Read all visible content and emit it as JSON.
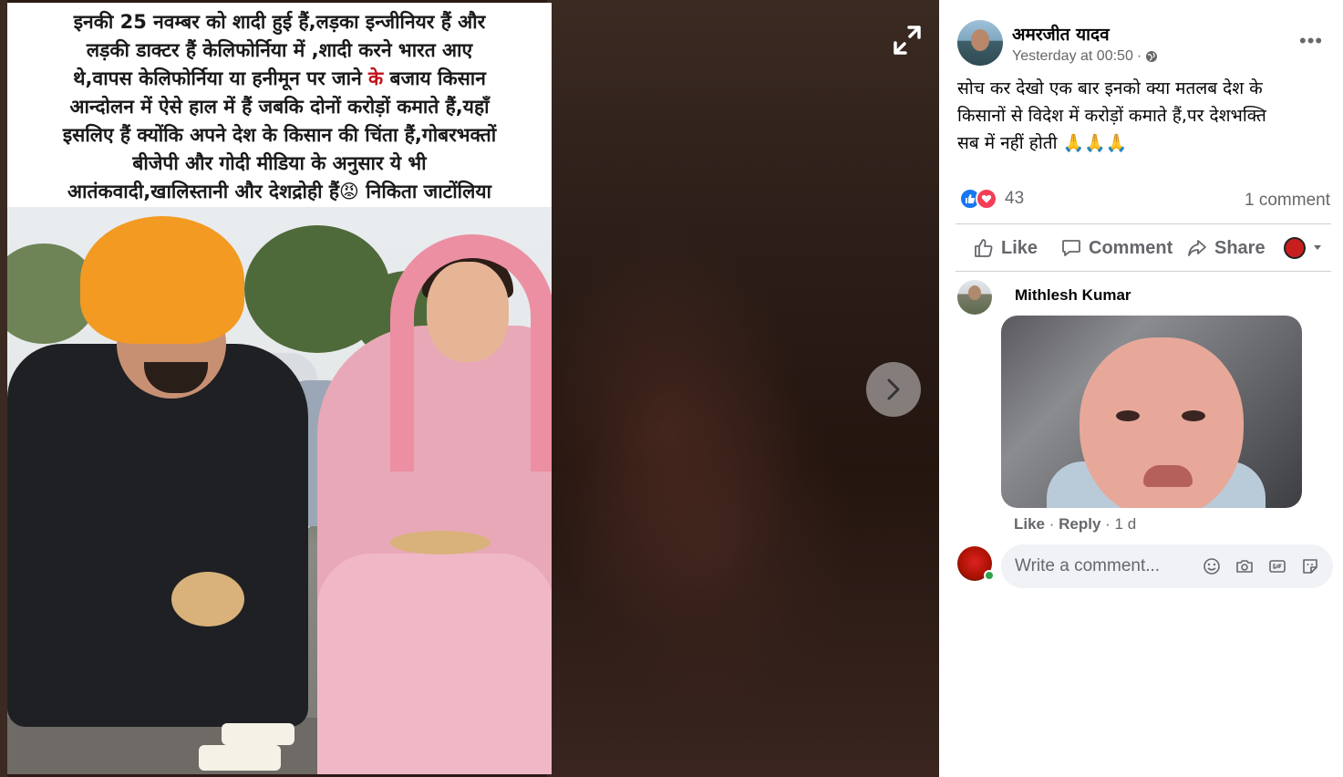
{
  "viewer": {
    "caption_line_1": "इनकी 25 नवम्बर को शादी हुई हैं,लड़का इन्जीनियर हैं और",
    "caption_line_2": "लड़की डाक्टर हैं केलिफोर्निया में ,शादी करने भारत आए",
    "caption_line_3a": "थे,वापस केलिफोर्निया या हनीमून पर जाने ",
    "caption_line_3b": "के",
    "caption_line_3c": " बजाय किसान",
    "caption_line_4": "आन्दोलन में ऐसे हाल में हैं जबकि दोनों करोड़ों कमाते हैं,यहाँ",
    "caption_line_5": "इसलिए हैं क्योंकि अपने देश के किसान की चिंता हैं,गोबरभक्तों",
    "caption_line_6": "बीजेपी और गोदी मीडिया के अनुसार ये भी",
    "caption_line_7a": "आतंकवादी,खालिस्तानी और देशद्रोही हैं",
    "caption_line_7_emoji": "😡",
    "caption_line_7b": " निकिता जाटोंलिया",
    "icons": {
      "expand": "expand-icon",
      "next": "chevron-right-icon"
    }
  },
  "post": {
    "author_name": "अमरजीत यादव",
    "timestamp": "Yesterday at 00:50",
    "separator": "·",
    "audience_icon": "globe-icon",
    "more": "•••",
    "text_line_1": "सोच कर देखो एक बार इनको क्या मतलब देश के",
    "text_line_2": "किसानों से विदेश में करोड़ों कमाते हैं,पर देशभक्ति",
    "text_line_3": "सब में नहीं होती ",
    "text_emoji": "🙏🙏🙏",
    "reaction_count": "43",
    "comment_count": "1 comment"
  },
  "actions": {
    "like": "Like",
    "comment": "Comment",
    "share": "Share"
  },
  "comment": {
    "author": "Mithlesh Kumar",
    "like": "Like",
    "dot": " · ",
    "reply": "Reply",
    "time": " · 1 d"
  },
  "composer": {
    "placeholder": "Write a comment...",
    "icons": [
      "emoji-icon",
      "camera-icon",
      "gif-icon",
      "sticker-icon"
    ]
  },
  "colors": {
    "like_blue": "#1877f2",
    "love_red": "#f33e58",
    "secondary_text": "#65676b",
    "online_green": "#31a24c"
  }
}
